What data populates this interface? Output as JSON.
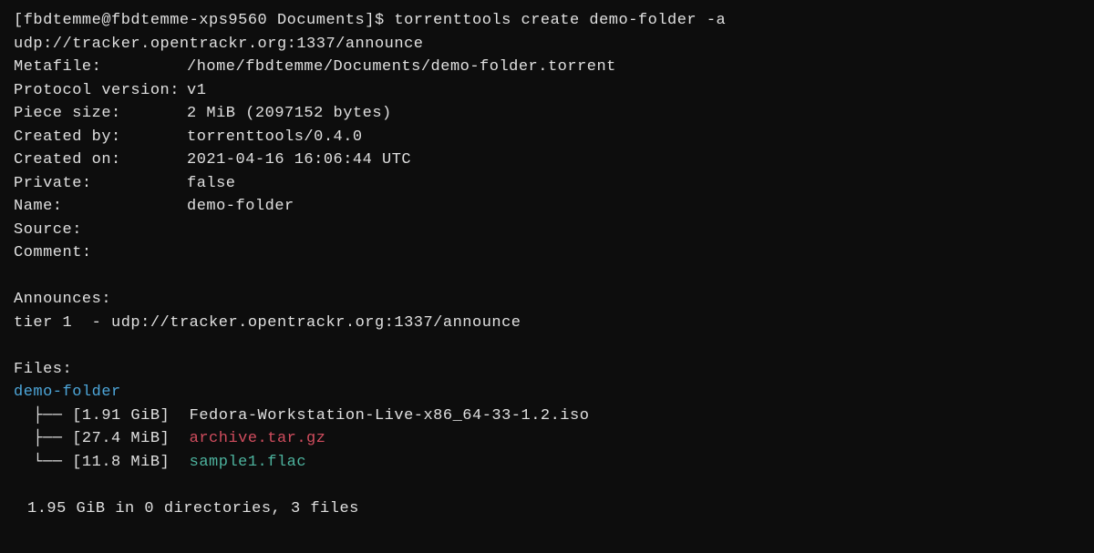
{
  "prompt": {
    "user_host": "[fbdtemme@fbdtemme-xps9560 Documents]$",
    "command": "torrenttools create demo-folder -a udp://tracker.opentrackr.org:1337/announce"
  },
  "info": {
    "metafile_label": "Metafile:",
    "metafile_value": "/home/fbdtemme/Documents/demo-folder.torrent",
    "protocol_label": "Protocol version:",
    "protocol_value": "v1",
    "piece_label": "Piece size:",
    "piece_value": "2 MiB (2097152 bytes)",
    "created_by_label": "Created by:",
    "created_by_value": "torrenttools/0.4.0",
    "created_on_label": "Created on:",
    "created_on_value": "2021-04-16 16:06:44 UTC",
    "private_label": "Private:",
    "private_value": "false",
    "name_label": "Name:",
    "name_value": "demo-folder",
    "source_label": "Source:",
    "source_value": "",
    "comment_label": "Comment:",
    "comment_value": ""
  },
  "announces": {
    "header": "Announces:",
    "tier_label": "tier 1",
    "tier_url": "- udp://tracker.opentrackr.org:1337/announce"
  },
  "files": {
    "header": "Files:",
    "root": "demo-folder",
    "items": [
      {
        "branch": "  ├── ",
        "size": "[1.91 GiB]",
        "name": "Fedora-Workstation-Live-x86_64-33-1.2.iso",
        "class": ""
      },
      {
        "branch": "  ├── ",
        "size": "[27.4 MiB]",
        "name": "archive.tar.gz",
        "class": "file-archive"
      },
      {
        "branch": "  └── ",
        "size": "[11.8 MiB]",
        "name": "sample1.flac",
        "class": "file-audio"
      }
    ],
    "summary": "1.95 GiB in 0 directories, 3 files"
  }
}
